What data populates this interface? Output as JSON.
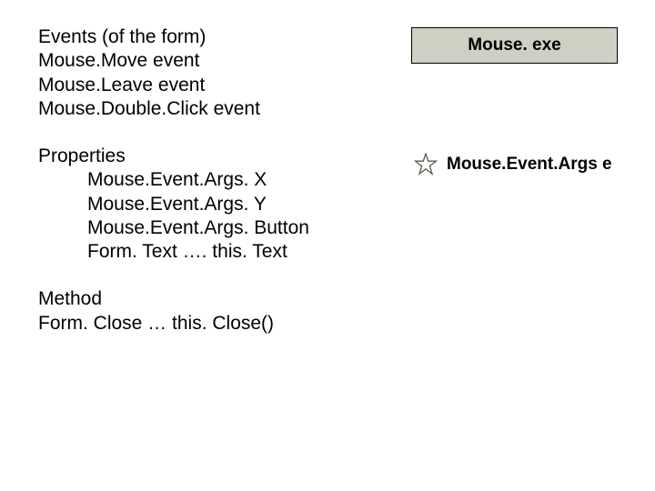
{
  "events": {
    "heading": "Events (of the form)",
    "items": [
      "Mouse.Move event",
      "Mouse.Leave event",
      "Mouse.Double.Click event"
    ]
  },
  "properties": {
    "heading": "Properties",
    "items": [
      "Mouse.Event.Args. X",
      "Mouse.Event.Args. Y",
      "Mouse.Event.Args. Button",
      "Form. Text ….  this. Text"
    ]
  },
  "method": {
    "heading": "Method",
    "line": "Form. Close … this. Close()"
  },
  "exe_label": "Mouse. exe",
  "star_label": "Mouse.Event.Args e"
}
